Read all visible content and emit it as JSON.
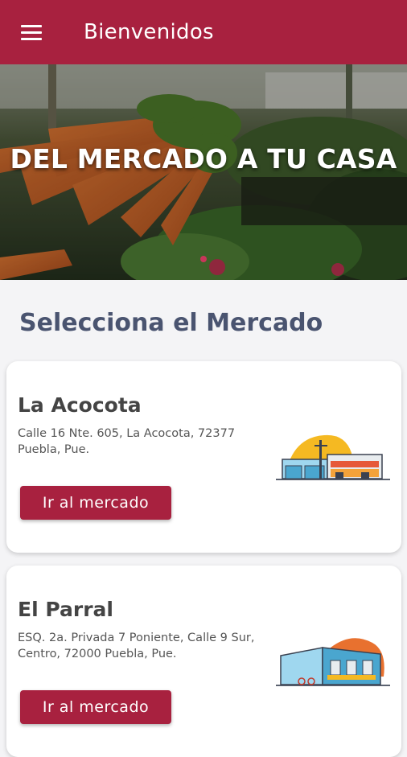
{
  "appbar": {
    "title": "Bienvenidos",
    "menu_icon": "hamburger-menu-icon",
    "color": "#a8213f"
  },
  "hero": {
    "title": "DEL MERCADO A TU CASA",
    "slides_count": 1,
    "active_slide": 0
  },
  "section": {
    "title": "Selecciona el Mercado"
  },
  "markets": [
    {
      "name": "La Acocota",
      "address": "Calle 16 Nte. 605, La Acocota, 72377 Puebla, Pue.",
      "button_label": "Ir al mercado",
      "illustration": "market-building-icon"
    },
    {
      "name": "El Parral",
      "address": "ESQ. 2a. Privada 7 Poniente, Calle 9 Sur, Centro, 72000 Puebla, Pue.",
      "button_label": "Ir al mercado",
      "illustration": "market-building-icon"
    }
  ]
}
